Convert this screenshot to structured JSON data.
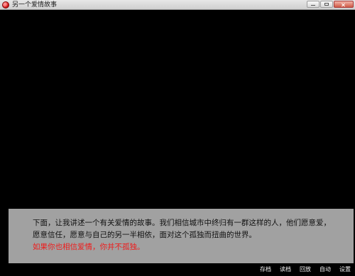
{
  "window": {
    "title": "另一个爱情故事"
  },
  "dialogue": {
    "paragraph": "下面，让我讲述一个有关爱情的故事。我们相信城市中终归有一群这样的人，他们愿意爱，愿意信任，愿意与自己的另一半相依，面对这个孤独而扭曲的世界。",
    "highlight": "如果你也相信爱情，你并不孤独。"
  },
  "menu": {
    "items": [
      "存档",
      "读档",
      "回放",
      "自动",
      "设置"
    ]
  },
  "icons": {
    "app": "app-icon",
    "minimize": "minimize-icon",
    "maximize": "maximize-icon",
    "close": "close-icon"
  },
  "colors": {
    "background": "#000000",
    "dialogue_box": "#a8a8a8",
    "highlight": "#ef1b1b",
    "menu_text": "#f2f2f2"
  }
}
